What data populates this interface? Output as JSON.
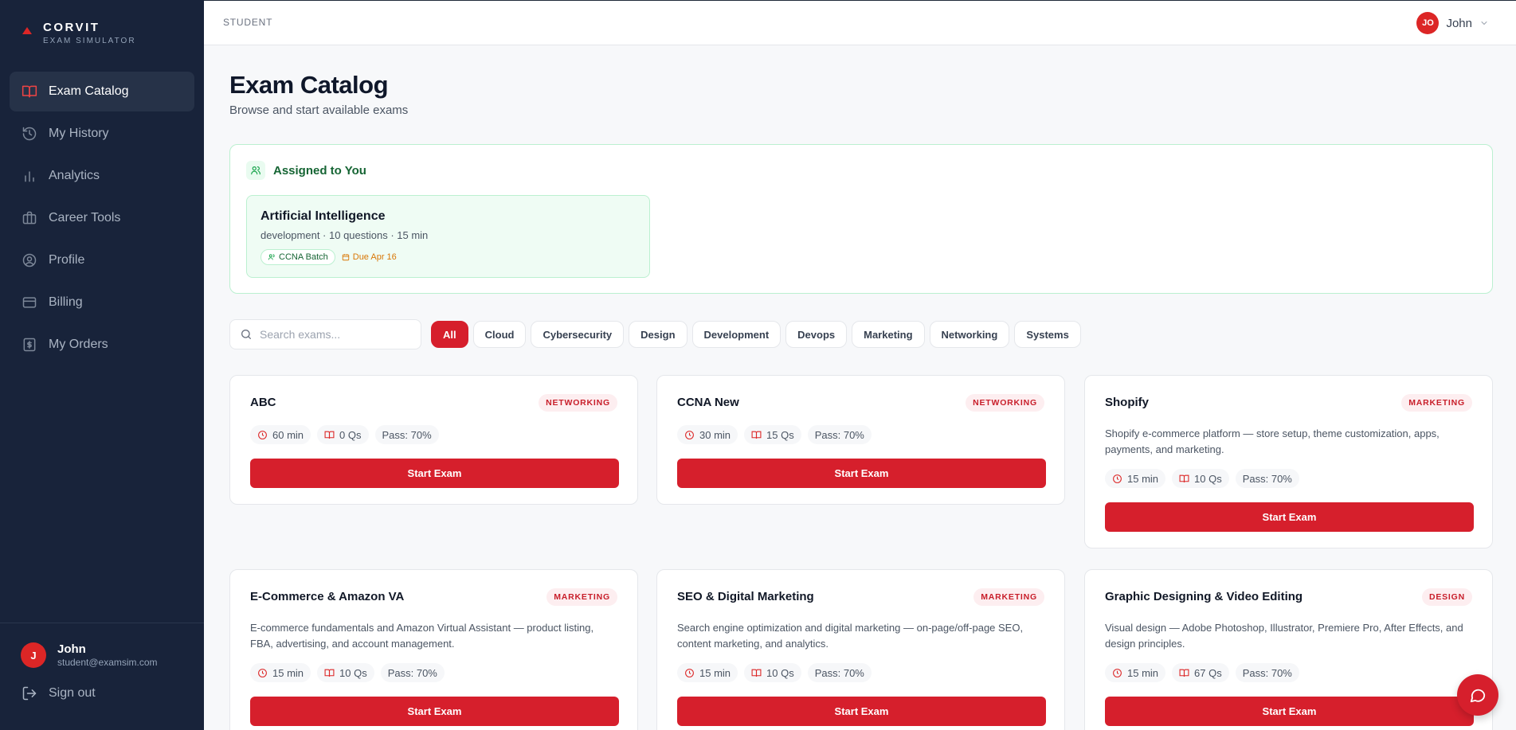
{
  "brand": {
    "name": "CORVIT",
    "subtitle": "EXAM SIMULATOR"
  },
  "sidebar": {
    "items": [
      {
        "label": "Exam Catalog",
        "icon": "book-open-icon",
        "active": true
      },
      {
        "label": "My History",
        "icon": "history-icon"
      },
      {
        "label": "Analytics",
        "icon": "bar-chart-icon"
      },
      {
        "label": "Career Tools",
        "icon": "briefcase-icon"
      },
      {
        "label": "Profile",
        "icon": "user-circle-icon"
      },
      {
        "label": "Billing",
        "icon": "credit-card-icon"
      },
      {
        "label": "My Orders",
        "icon": "receipt-icon"
      }
    ],
    "user": {
      "initial": "J",
      "name": "John",
      "email": "student@examsim.com"
    },
    "signout_label": "Sign out"
  },
  "header": {
    "breadcrumb": "STUDENT",
    "user_initials": "JO",
    "user_name": "John"
  },
  "page": {
    "title": "Exam Catalog",
    "subtitle": "Browse and start available exams"
  },
  "assigned": {
    "heading": "Assigned to You",
    "card": {
      "title": "Artificial Intelligence",
      "meta": "development · 10 questions · 15 min",
      "batch": "CCNA Batch",
      "due": "Due Apr 16"
    }
  },
  "search": {
    "placeholder": "Search exams...",
    "value": ""
  },
  "filters": [
    "All",
    "Cloud",
    "Cybersecurity",
    "Design",
    "Development",
    "Devops",
    "Marketing",
    "Networking",
    "Systems"
  ],
  "active_filter": "All",
  "exams": [
    {
      "title": "ABC",
      "category": "NETWORKING",
      "description": "",
      "duration": "60 min",
      "questions": "0 Qs",
      "pass": "Pass: 70%",
      "button": "Start Exam"
    },
    {
      "title": "CCNA New",
      "category": "NETWORKING",
      "description": "",
      "duration": "30 min",
      "questions": "15 Qs",
      "pass": "Pass: 70%",
      "button": "Start Exam"
    },
    {
      "title": "Shopify",
      "category": "MARKETING",
      "description": "Shopify e-commerce platform — store setup, theme customization, apps, payments, and marketing.",
      "duration": "15 min",
      "questions": "10 Qs",
      "pass": "Pass: 70%",
      "button": "Start Exam"
    },
    {
      "title": "E-Commerce & Amazon VA",
      "category": "MARKETING",
      "description": "E-commerce fundamentals and Amazon Virtual Assistant — product listing, FBA, advertising, and account management.",
      "duration": "15 min",
      "questions": "10 Qs",
      "pass": "Pass: 70%",
      "button": "Start Exam"
    },
    {
      "title": "SEO & Digital Marketing",
      "category": "MARKETING",
      "description": "Search engine optimization and digital marketing — on-page/off-page SEO, content marketing, and analytics.",
      "duration": "15 min",
      "questions": "10 Qs",
      "pass": "Pass: 70%",
      "button": "Start Exam"
    },
    {
      "title": "Graphic Designing & Video Editing",
      "category": "DESIGN",
      "description": "Visual design — Adobe Photoshop, Illustrator, Premiere Pro, After Effects, and design principles.",
      "duration": "15 min",
      "questions": "67 Qs",
      "pass": "Pass: 70%",
      "button": "Start Exam"
    }
  ],
  "colors": {
    "sidebar_bg": "#18233a",
    "accent": "#d61f2c",
    "assigned_green": "#166534",
    "due_orange": "#d97706"
  }
}
